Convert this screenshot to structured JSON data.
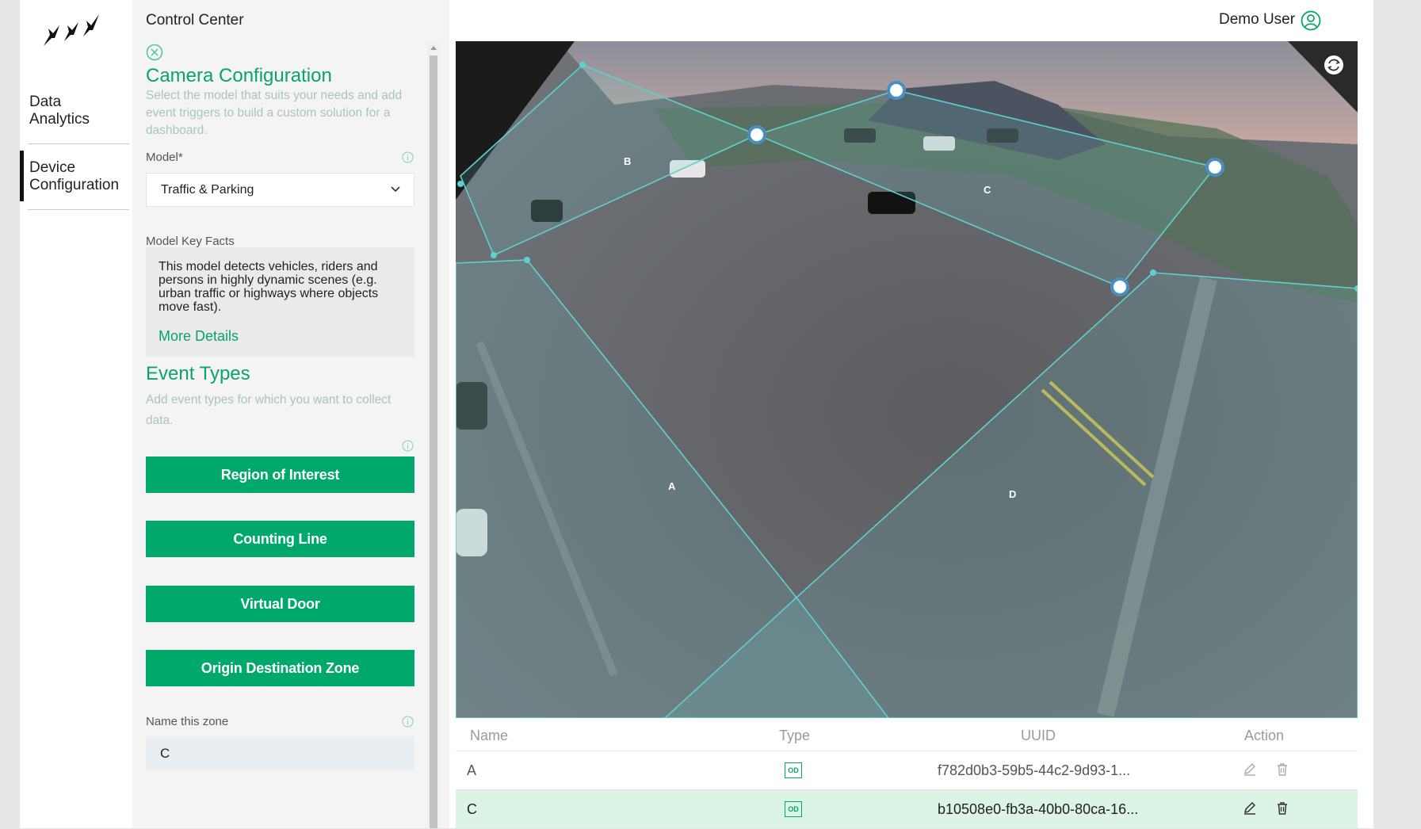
{
  "nav": {
    "items": [
      {
        "label": "Data Analytics"
      },
      {
        "label": "Device Configuration"
      }
    ]
  },
  "header": {
    "title": "Control Center",
    "user": "Demo User"
  },
  "panel": {
    "title": "Camera Configuration",
    "subtitle": "Select the model that suits your needs and add event triggers to build a custom solution for a dashboard.",
    "model_label": "Model*",
    "model_value": "Traffic & Parking",
    "facts_label": "Model Key Facts",
    "facts_text": "This model detects vehicles, riders and persons in highly dynamic scenes (e.g. urban traffic or highways where objects move fast).",
    "more_details": "More Details",
    "events_title": "Event Types",
    "events_subtitle": "Add event types for which you want to collect data.",
    "buttons": [
      "Region of Interest",
      "Counting Line",
      "Virtual Door",
      "Origin Destination Zone"
    ],
    "zone_label": "Name this zone",
    "zone_value": "C"
  },
  "camera": {
    "zone_labels": [
      "A",
      "B",
      "C",
      "D"
    ]
  },
  "table": {
    "headers": {
      "name": "Name",
      "type": "Type",
      "uuid": "UUID",
      "action": "Action"
    },
    "rows": [
      {
        "name": "A",
        "type": "OD",
        "uuid": "f782d0b3-59b5-44c2-9d93-1...",
        "selected": false
      },
      {
        "name": "C",
        "type": "OD",
        "uuid": "b10508e0-fb3a-40b0-80ca-16...",
        "selected": true
      }
    ]
  },
  "colors": {
    "accent": "#00a86b",
    "zone_line": "#5fd0d0",
    "selected_row": "#dbf4e6"
  }
}
